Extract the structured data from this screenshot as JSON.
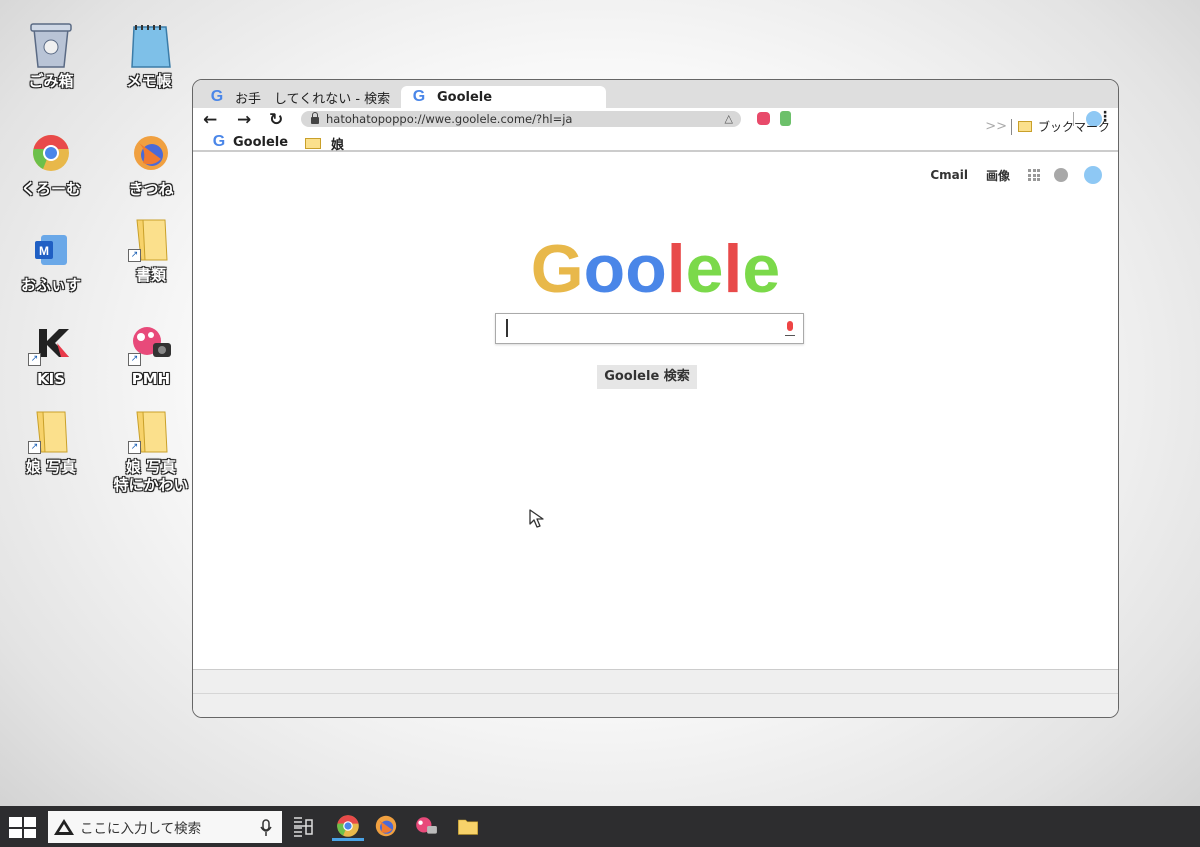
{
  "desktop": {
    "icons": [
      {
        "label": "ごみ箱",
        "icon": "trash-icon"
      },
      {
        "label": "メモ帳",
        "icon": "notepad-icon"
      },
      {
        "label": "くろーむ",
        "icon": "chrome-icon"
      },
      {
        "label": "きつね",
        "icon": "firefox-icon"
      },
      {
        "label": "おふぃす",
        "icon": "office-icon"
      },
      {
        "label": "書類",
        "icon": "folder-icon"
      },
      {
        "label": "KIS",
        "icon": "kis-icon"
      },
      {
        "label": "PMH",
        "icon": "pmh-icon"
      },
      {
        "label": "娘 写真",
        "icon": "folder-icon"
      },
      {
        "label": "娘 写真",
        "label2": "特にかわい",
        "icon": "folder-icon"
      }
    ]
  },
  "browser": {
    "tabs": [
      {
        "title": "お手　してくれない - 検索"
      },
      {
        "title": "Goolele"
      }
    ],
    "nav": {
      "back": "←",
      "forward": "→",
      "reload": "↻"
    },
    "url": "hatohatopoppo://wwe.goolele.come/?hl=ja",
    "bookmarks": [
      {
        "label": "Goolele"
      },
      {
        "label": "娘"
      }
    ],
    "bookmark_overflow": ">>",
    "bookmark_folder": "ブックマーク",
    "header_links": {
      "mail": "Cmail",
      "images": "画像"
    },
    "logo": {
      "letters": [
        "G",
        "o",
        "o",
        "l",
        "e",
        "l",
        "e"
      ],
      "colors": [
        "#e8b84a",
        "#4a86e8",
        "#4a86e8",
        "#e84a4a",
        "#7bd94a",
        "#e84a4a",
        "#7bd94a"
      ]
    },
    "search": {
      "value": "",
      "button_label": "Goolele 検索"
    }
  },
  "taskbar": {
    "search_placeholder": "ここに入力して検索",
    "apps": [
      "chrome-icon",
      "firefox-icon",
      "pmh-icon",
      "folder-icon"
    ]
  }
}
